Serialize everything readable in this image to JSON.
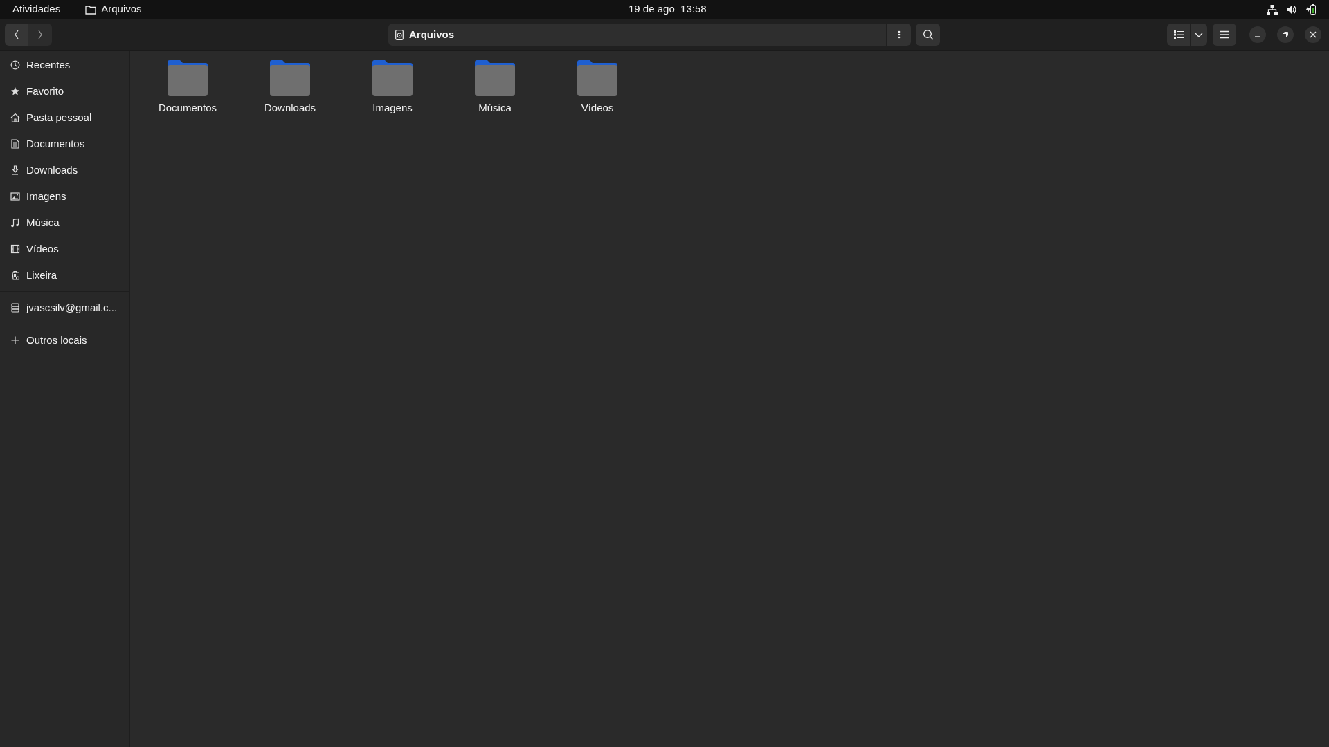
{
  "top_bar": {
    "activities": "Atividades",
    "app_name": "Arquivos",
    "clock": "19 de ago  13:58"
  },
  "header": {
    "location": "Arquivos"
  },
  "sidebar": {
    "items": [
      {
        "kind": "recent",
        "label": "Recentes"
      },
      {
        "kind": "starred",
        "label": "Favorito"
      },
      {
        "kind": "home",
        "label": "Pasta pessoal"
      },
      {
        "kind": "document",
        "label": "Documentos"
      },
      {
        "kind": "download",
        "label": "Downloads"
      },
      {
        "kind": "picture",
        "label": "Imagens"
      },
      {
        "kind": "music",
        "label": "Música"
      },
      {
        "kind": "video",
        "label": "Vídeos"
      },
      {
        "kind": "trash",
        "label": "Lixeira"
      },
      {
        "kind": "account",
        "label": "jvascsilv@gmail.c..."
      },
      {
        "kind": "other",
        "label": "Outros locais"
      }
    ]
  },
  "files": [
    {
      "name": "Documentos"
    },
    {
      "name": "Downloads"
    },
    {
      "name": "Imagens"
    },
    {
      "name": "Música"
    },
    {
      "name": "Vídeos"
    }
  ]
}
